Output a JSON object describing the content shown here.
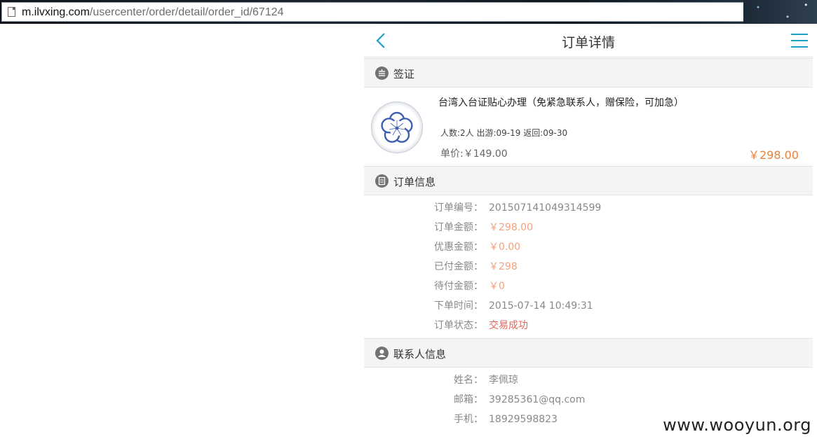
{
  "browser": {
    "url_host": "m.ilvxing.com",
    "url_path": "/usercenter/order/detail/order_id/67124"
  },
  "nav": {
    "title": "订单详情",
    "back_icon": "chevron-left-icon",
    "menu_icon": "hamburger-menu-icon",
    "accent_color": "#1aa1c7"
  },
  "visa": {
    "section_label": "签证",
    "product_title": "台湾入台证贴心办理（免紧急联系人，赠保险，可加急）",
    "meta": "人数:2人 出游:09-19 返回:09-30",
    "unit_price": "单价:￥149.00",
    "total_price": "￥298.00"
  },
  "order_info": {
    "section_label": "订单信息",
    "rows": [
      {
        "label": "订单编号：",
        "value": "201507141049314599",
        "kind": "plain"
      },
      {
        "label": "订单金额：",
        "value": "￥298.00",
        "kind": "money"
      },
      {
        "label": "优惠金额：",
        "value": "￥0.00",
        "kind": "money"
      },
      {
        "label": "已付金额：",
        "value": "￥298",
        "kind": "money"
      },
      {
        "label": "待付金额：",
        "value": "￥0",
        "kind": "money"
      },
      {
        "label": "下单时间：",
        "value": "2015-07-14 10:49:31",
        "kind": "plain"
      },
      {
        "label": "订单状态：",
        "value": "交易成功",
        "kind": "status"
      }
    ]
  },
  "contact": {
    "section_label": "联系人信息",
    "rows": [
      {
        "label": "姓名：",
        "value": "李佩琼"
      },
      {
        "label": "邮箱：",
        "value": "39285361@qq.com"
      },
      {
        "label": "手机：",
        "value": "18929598823"
      }
    ]
  },
  "watermark": "www.wooyun.org"
}
